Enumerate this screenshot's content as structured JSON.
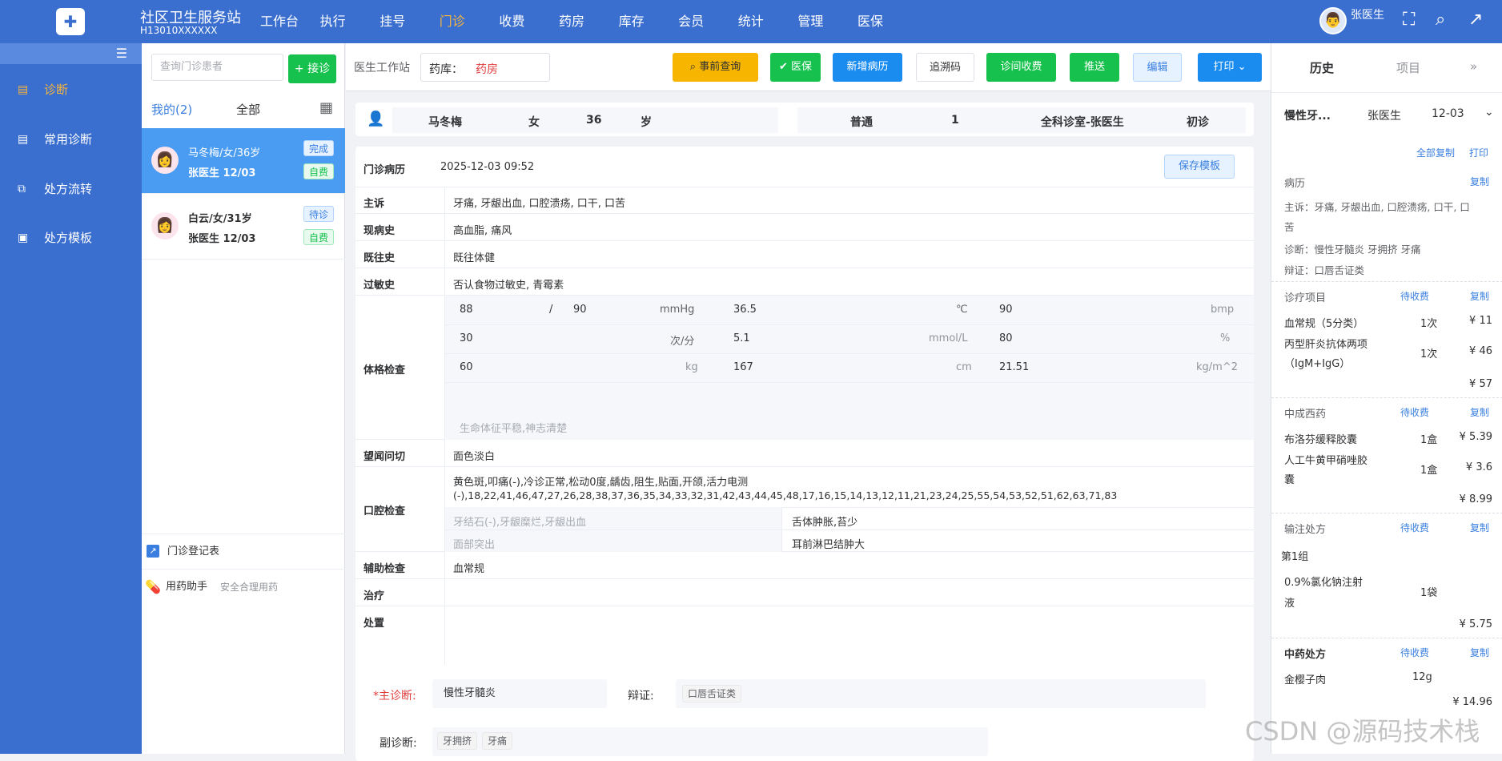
{
  "app": {
    "name": "社区卫生服务站",
    "code": "H13010XXXXXX"
  },
  "nav": [
    "工作台",
    "执行",
    "挂号",
    "门诊",
    "收费",
    "药房",
    "库存",
    "会员",
    "统计",
    "管理",
    "医保"
  ],
  "nav_active": "门诊",
  "user": {
    "name": "张医生"
  },
  "sidebar": {
    "items": [
      {
        "label": "诊断",
        "icon": "diagnosis-icon",
        "active": true
      },
      {
        "label": "常用诊断",
        "icon": "doc-icon"
      },
      {
        "label": "处方流转",
        "icon": "flow-icon"
      },
      {
        "label": "处方模板",
        "icon": "template-icon"
      }
    ]
  },
  "patients": {
    "search_placeholder": "查询门诊患者",
    "receive_btn": "+ 接诊",
    "tab_mine": "我的(2)",
    "tab_all": "全部",
    "list": [
      {
        "info": "马冬梅/女/36岁",
        "doctor": "张医生 12/03",
        "status": "完成",
        "pay": "自费"
      },
      {
        "info": "白云/女/31岁",
        "doctor": "张医生 12/03",
        "status": "待诊",
        "pay": "自费"
      }
    ],
    "register": "门诊登记表",
    "assist": "用药助手",
    "assist_sub": "安全合理用药"
  },
  "toolbar": {
    "label": "医生工作站",
    "pharmacy_label": "药库：",
    "pharmacy_value": "药房",
    "buttons": [
      {
        "text": "事前查询",
        "color": "#f7b500",
        "fg": "#303133"
      },
      {
        "text": "医保",
        "color": "#16c24d",
        "fg": "#fff"
      },
      {
        "text": "新增病历",
        "color": "#1a8cf0",
        "fg": "#fff"
      },
      {
        "text": "追溯码",
        "color": "#fff",
        "fg": "#303133"
      },
      {
        "text": "诊间收费",
        "color": "#16c24d",
        "fg": "#fff"
      },
      {
        "text": "推送",
        "color": "#16c24d",
        "fg": "#fff"
      },
      {
        "text": "编辑",
        "color": "#e6f2ff",
        "fg": "#3a7fe0"
      },
      {
        "text": "打印",
        "color": "#1a8cf0",
        "fg": "#fff"
      }
    ]
  },
  "patient_bar": {
    "name": "马冬梅",
    "gender": "女",
    "age": "36",
    "age_unit": "岁",
    "type": "普通",
    "number": "1",
    "dept": "全科诊室-张医生",
    "visit": "初诊"
  },
  "record": {
    "title": "门诊病历",
    "datetime": "2025-12-03 09:52",
    "save_tpl": "保存模板",
    "rows": [
      {
        "label": "主诉",
        "value": "牙痛, 牙龈出血, 口腔溃疡, 口干, 口苦"
      },
      {
        "label": "现病史",
        "value": "高血脂, 痛风"
      },
      {
        "label": "既往史",
        "value": "既往体健"
      },
      {
        "label": "过敏史",
        "value": "否认食物过敏史, 青霉素"
      }
    ],
    "exam_label": "体格检查",
    "vitals": [
      [
        "88",
        "/",
        "90",
        "mmHg",
        "36.5",
        "℃",
        "90",
        "bmp"
      ],
      [
        "30",
        "",
        "",
        "次/分",
        "5.1",
        "mmol/L",
        "80",
        "%"
      ],
      [
        "60",
        "",
        "",
        "kg",
        "167",
        "cm",
        "21.51",
        "kg/m^2"
      ]
    ],
    "exam_note": "生命体征平稳,神志清楚",
    "tcm_label": "望闻问切",
    "tcm_value": "面色淡白",
    "oral_label": "口腔检查",
    "oral_line1": "黄色斑,叩痛(-),冷诊正常,松动0度,龋齿,阻生,贴面,开颌,活力电测",
    "oral_line2": "(-),18,22,41,46,47,27,26,28,38,37,36,35,34,33,32,31,42,43,44,45,48,17,16,15,14,13,12,11,21,23,24,25,55,54,53,52,51,62,63,71,83",
    "oral_a1": "牙结石(-),牙龈糜烂,牙龈出血",
    "oral_b1": "舌体肿胀,苔少",
    "oral_a2": "面部突出",
    "oral_b2": "耳前淋巴结肿大",
    "aux_label": "辅助检查",
    "aux_value": "血常规",
    "treat_label": "治疗",
    "handle_label": "处置"
  },
  "diagnosis": {
    "main_label": "*主诊断:",
    "main_value": "慢性牙髓炎",
    "syndrome_label": "辩证:",
    "syndrome_value": "口唇舌证类",
    "sub_label": "副诊断:",
    "sub_tags": [
      "牙拥挤",
      "牙痛"
    ]
  },
  "right": {
    "tab_history": "历史",
    "tab_items": "项目",
    "summary": {
      "diag": "慢性牙...",
      "doctor": "张医生",
      "date": "12-03"
    },
    "copy_all": "全部复制",
    "print": "打印",
    "record_title": "病历",
    "copy": "复制",
    "record_lines": [
      "主诉：牙痛, 牙龈出血, 口腔溃疡, 口干, 口",
      "苦",
      "诊断：慢性牙髓炎 牙拥挤 牙痛",
      "辩证：口唇舌证类"
    ],
    "treat_title": "诊疗项目",
    "pending": "待收费",
    "treat_items": [
      {
        "name": "血常规（5分类）",
        "qty": "1次",
        "price": "¥ 11"
      },
      {
        "name": "丙型肝炎抗体两项",
        "name2": "（IgM+IgG）",
        "qty": "1次",
        "price": "¥ 46"
      }
    ],
    "treat_total": "¥ 57",
    "med_title": "中成西药",
    "med_items": [
      {
        "name": "布洛芬缓释胶囊",
        "qty": "1盒",
        "price": "¥ 5.39"
      },
      {
        "name": "人工牛黄甲硝唑胶",
        "name2": "囊",
        "qty": "1盒",
        "price": "¥ 3.6"
      }
    ],
    "med_total": "¥ 8.99",
    "iv_title": "输注处方",
    "iv_group": "第1组",
    "iv_item": "0.9%氯化钠注射",
    "iv_item2": "液",
    "iv_qty": "1袋",
    "iv_total": "¥ 5.75",
    "tcm_title": "中药处方",
    "tcm_item": "金樱子肉",
    "tcm_qty": "12g",
    "tcm_total": "¥ 14.96"
  },
  "watermark": "CSDN @源码技术栈",
  "colors": {
    "primary": "#3a6fd0",
    "accent": "#f6b53d",
    "green": "#16c24d",
    "blue": "#1a8cf0"
  }
}
